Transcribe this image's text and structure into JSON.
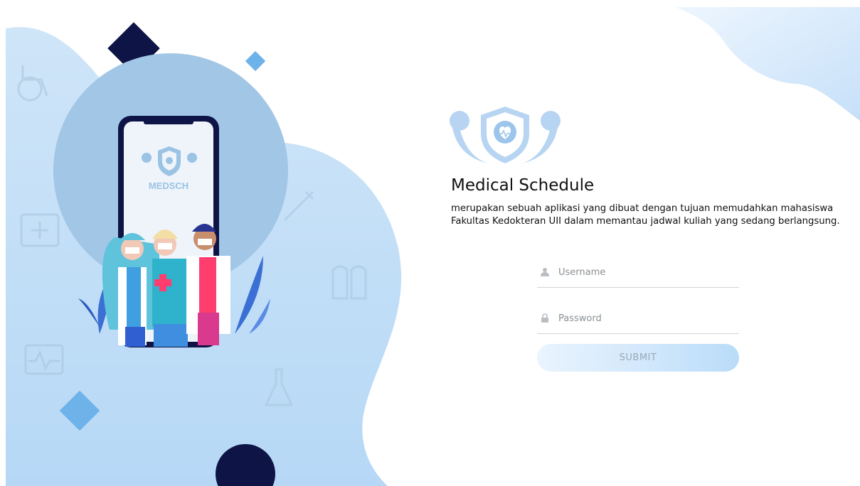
{
  "app": {
    "title": "Medical Schedule",
    "description": "merupakan sebuah aplikasi yang dibuat dengan tujuan memudahkan mahasiswa Fakultas Kedokteran UII dalam memantau jadwal kuliah yang sedang berlangsung.",
    "phone_logo_text": "MEDSCH"
  },
  "form": {
    "username_placeholder": "Username",
    "password_placeholder": "Password",
    "submit_label": "SUBMIT"
  },
  "icons": {
    "username": "user-icon",
    "password": "lock-icon",
    "brand": "shield-heart-logo-icon"
  },
  "colors": {
    "light_blue": "#bcdcf8",
    "circle_blue": "#a2c6e6",
    "navy": "#0f1446",
    "accent_blue": "#6eb2ea"
  }
}
